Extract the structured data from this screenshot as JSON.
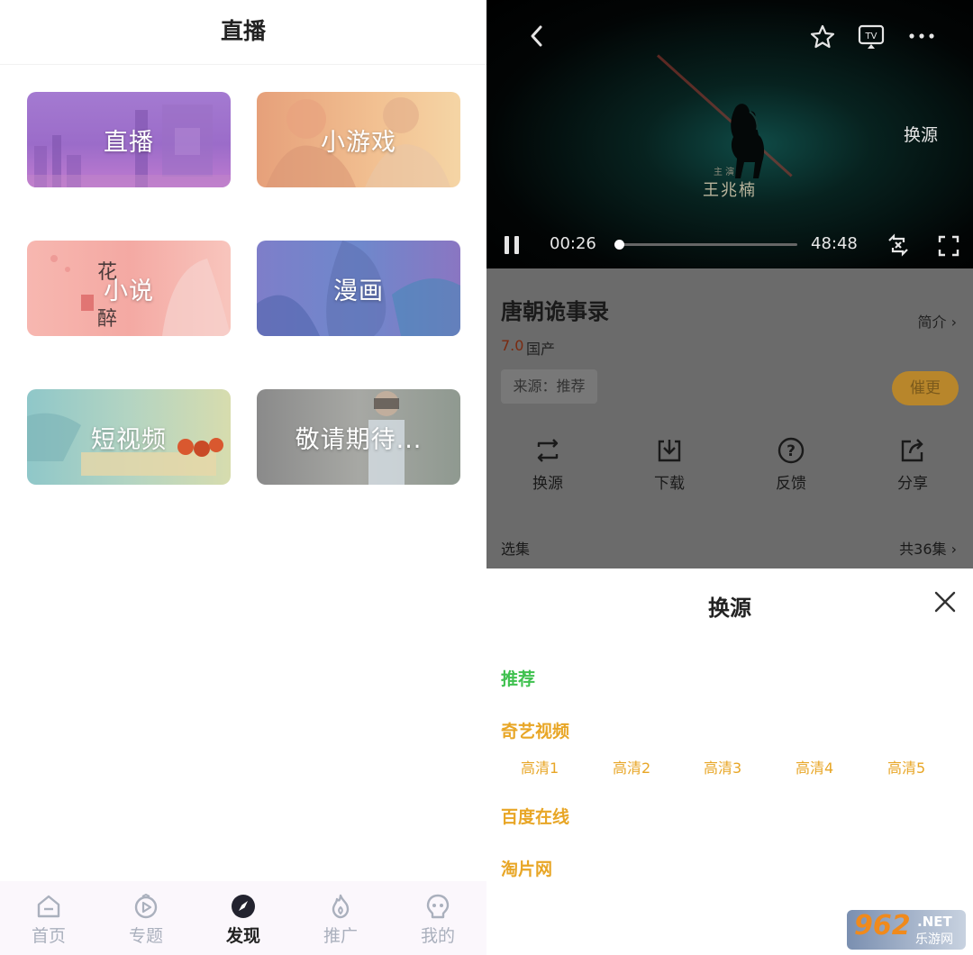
{
  "left": {
    "title": "直播",
    "tiles": [
      {
        "label": "直播"
      },
      {
        "label": "小游戏"
      },
      {
        "label": "小说"
      },
      {
        "label": "漫画"
      },
      {
        "label": "短视频"
      },
      {
        "label": "敬请期待..."
      }
    ],
    "tile2_art_text": "花 醉",
    "nav": [
      {
        "label": "首页",
        "icon": "home-icon"
      },
      {
        "label": "专题",
        "icon": "topic-icon"
      },
      {
        "label": "发现",
        "icon": "compass-icon",
        "active": true
      },
      {
        "label": "推广",
        "icon": "flame-icon"
      },
      {
        "label": "我的",
        "icon": "profile-icon"
      }
    ]
  },
  "player": {
    "actor_name": "王兆楠",
    "actor_small": "主 演",
    "switch_source": "换源",
    "current_time": "00:26",
    "total_time": "48:48",
    "progress": 0.01
  },
  "info": {
    "title": "唐朝诡事录",
    "intro": "简介 ›",
    "rating": "7.0",
    "region": "国产",
    "source_tag": "来源：推荐",
    "urge_button": "催更",
    "actions": [
      {
        "label": "换源",
        "icon": "swap-icon"
      },
      {
        "label": "下载",
        "icon": "download-icon"
      },
      {
        "label": "反馈",
        "icon": "question-icon"
      },
      {
        "label": "分享",
        "icon": "share-icon"
      }
    ],
    "episodes_label": "选集",
    "episodes_count": "共36集 ›"
  },
  "sheet": {
    "title": "换源",
    "groups": [
      {
        "name": "推荐",
        "color": "#3fc14f"
      },
      {
        "name": "奇艺视频",
        "color": "#e8a626"
      },
      {
        "name": "百度在线",
        "color": "#e8a626"
      },
      {
        "name": "淘片网",
        "color": "#e8a626"
      }
    ],
    "qualities": [
      "高清1",
      "高清2",
      "高清3",
      "高清4",
      "高清5"
    ]
  },
  "watermark": {
    "brand": "962",
    "suffix": ".NET",
    "sub": "乐游网"
  },
  "colors": {
    "accent": "#e8a626",
    "green": "#3fc14f"
  }
}
